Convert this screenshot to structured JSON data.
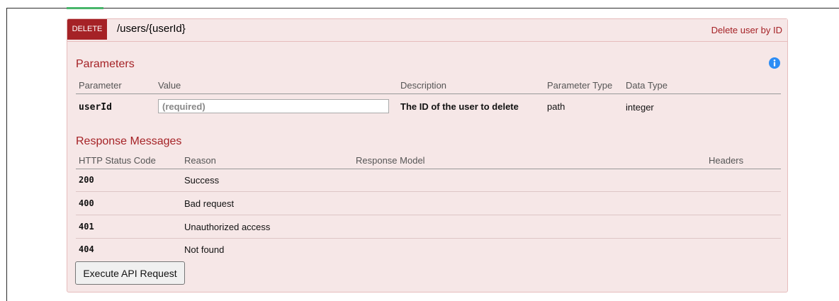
{
  "operation": {
    "method": "DELETE",
    "path": "/users/{userId}",
    "summary": "Delete user by ID"
  },
  "parameters": {
    "title": "Parameters",
    "columns": [
      "Parameter",
      "Value",
      "Description",
      "Parameter Type",
      "Data Type"
    ],
    "rows": [
      {
        "name": "userId",
        "placeholder": "(required)",
        "description": "The ID of the user to delete",
        "param_type": "path",
        "data_type": "integer"
      }
    ]
  },
  "responses": {
    "title": "Response Messages",
    "columns": [
      "HTTP Status Code",
      "Reason",
      "Response Model",
      "Headers"
    ],
    "rows": [
      {
        "code": "200",
        "reason": "Success"
      },
      {
        "code": "400",
        "reason": "Bad request"
      },
      {
        "code": "401",
        "reason": "Unauthorized access"
      },
      {
        "code": "404",
        "reason": "Not found"
      }
    ]
  },
  "execute_label": "Execute API Request",
  "colors": {
    "accent": "#a52226",
    "panel_bg": "#f6e7e7",
    "info": "#2d8df5"
  },
  "icons": [
    "info-icon"
  ]
}
